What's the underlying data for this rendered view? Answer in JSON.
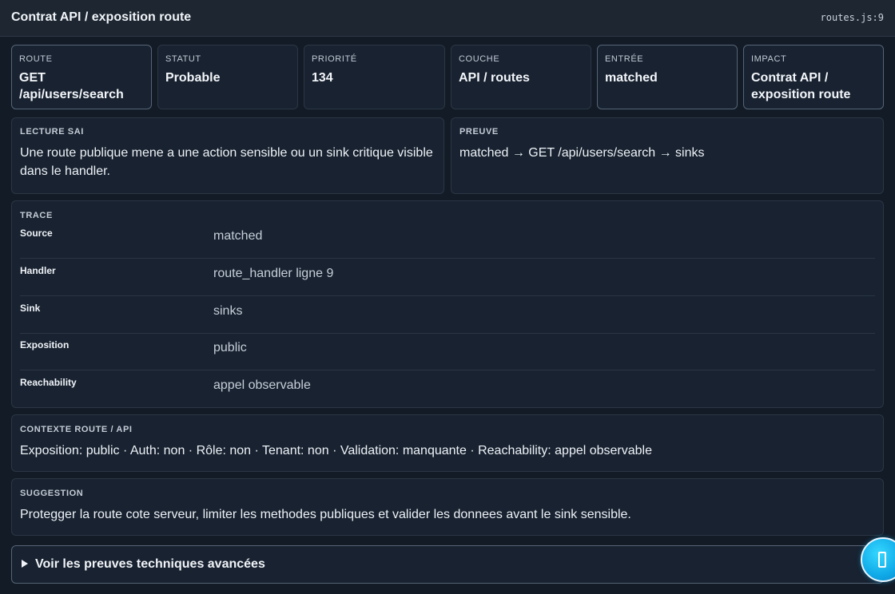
{
  "header": {
    "title": "Contrat API / exposition route",
    "file": "routes.js:9"
  },
  "stats": [
    {
      "label": "ROUTE",
      "value": "GET /api/users/search"
    },
    {
      "label": "STATUT",
      "value": "Probable"
    },
    {
      "label": "PRIORITÉ",
      "value": "134"
    },
    {
      "label": "COUCHE",
      "value": "API / routes"
    },
    {
      "label": "ENTRÉE",
      "value": "matched"
    },
    {
      "label": "IMPACT",
      "value": "Contrat API / exposition route"
    }
  ],
  "lecture": {
    "label": "LECTURE SAI",
    "text": "Une route publique mene a une action sensible ou un sink critique visible dans le handler."
  },
  "preuve": {
    "label": "PREUVE",
    "text": "matched → GET /api/users/search → sinks"
  },
  "trace": {
    "label": "TRACE",
    "rows": [
      {
        "key": "Source",
        "value": "matched"
      },
      {
        "key": "Handler",
        "value": "route_handler ligne 9"
      },
      {
        "key": "Sink",
        "value": "sinks"
      },
      {
        "key": "Exposition",
        "value": "public"
      },
      {
        "key": "Reachability",
        "value": "appel observable"
      }
    ]
  },
  "contexte": {
    "label": "CONTEXTE ROUTE / API",
    "text": "Exposition: public · Auth: non · Rôle: non · Tenant: non · Validation: manquante · Reachability: appel observable"
  },
  "suggestion": {
    "label": "SUGGESTION",
    "text": "Protegger la route cote serveur, limiter les methodes publiques et valider les donnees avant le sink sensible."
  },
  "details": {
    "label": "Voir les preuves techniques avancées"
  },
  "fab": {
    "icon": "assistant-icon",
    "accent": "#10a9e8"
  }
}
